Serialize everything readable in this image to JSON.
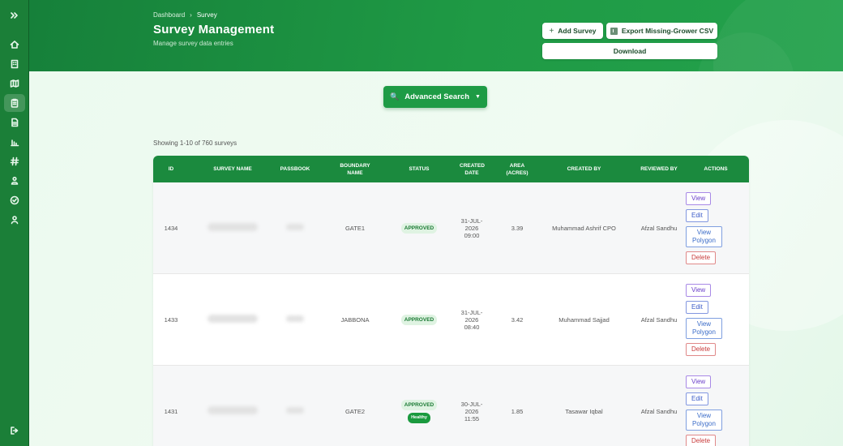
{
  "breadcrumb": {
    "home": "Dashboard",
    "separator": "›",
    "current": "Survey"
  },
  "page": {
    "title": "Survey Management",
    "subtitle": "Manage survey data entries"
  },
  "header_buttons": {
    "add": "Add Survey",
    "add_icon": "+",
    "export": "Export Missing-Grower CSV",
    "download": "Download"
  },
  "advanced_search": {
    "label": "Advanced Search",
    "icon": "🔍",
    "caret": "▼"
  },
  "showing": "Showing 1-10 of 760 surveys",
  "table": {
    "headers": [
      "ID",
      "SURVEY NAME",
      "PASSBOOK",
      "BOUNDARY NAME",
      "STATUS",
      "CREATED DATE",
      "AREA (ACRES)",
      "CREATED BY",
      "REVIEWED BY",
      "ACTIONS"
    ],
    "rows": [
      {
        "id": "1434",
        "boundary": "GATE1",
        "status": "APPROVED",
        "health": "",
        "date1": "31-JUL-",
        "date2": "2026",
        "date3": "09:00",
        "area": "3.39",
        "created_by": "Muhammad Ashrif CPO",
        "reviewed_by": "Afzal Sandhu"
      },
      {
        "id": "1433",
        "boundary": "JABBONA",
        "status": "APPROVED",
        "health": "",
        "date1": "31-JUL-",
        "date2": "2026",
        "date3": "08:40",
        "area": "3.42",
        "created_by": "Muhammad Sajjad",
        "reviewed_by": "Afzal Sandhu"
      },
      {
        "id": "1431",
        "boundary": "GATE2",
        "status": "APPROVED",
        "health": "Healthy",
        "date1": "30-JUL-",
        "date2": "2026",
        "date3": "11:55",
        "area": "1.85",
        "created_by": "Tasawar Iqbal",
        "reviewed_by": "Afzal Sandhu"
      }
    ],
    "actions": {
      "view": "View",
      "edit": "Edit",
      "polygon_1": "View",
      "polygon_2": "Polygon",
      "delete": "Delete"
    }
  },
  "sidebar": {
    "icons": [
      "expand-icon",
      "home-icon",
      "building-icon",
      "map-icon",
      "clipboard-icon",
      "document-icon",
      "chart-icon",
      "hash-icon",
      "users-icon",
      "check-circle-icon",
      "user-icon",
      "logout-icon"
    ],
    "active": "clipboard-icon"
  },
  "colors": {
    "primary": "#1b8a3e",
    "header_dark": "#16803a",
    "background": "#eefbf1",
    "approved_bg": "#dff3e2",
    "delete": "#c83b3b"
  }
}
